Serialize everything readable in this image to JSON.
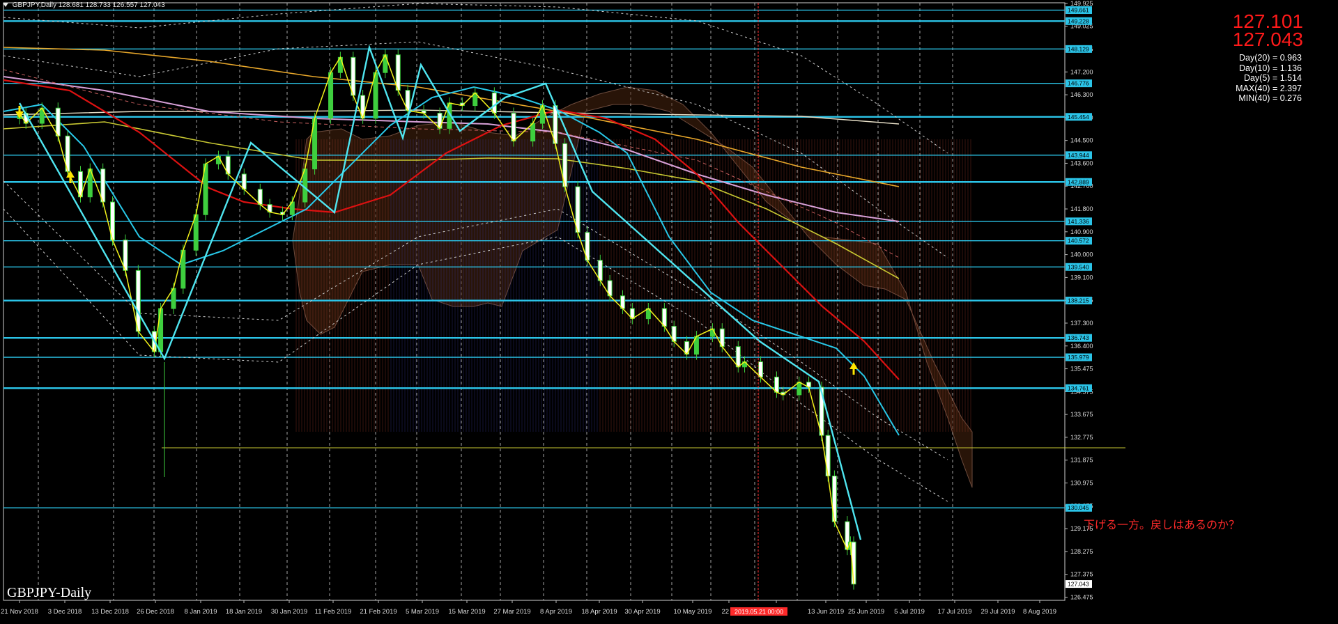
{
  "window": {
    "symbol_title": "GBPJPY,Daily",
    "ohlc": "128.681 128.733 126.557 127.043"
  },
  "quote": {
    "ask": "127.101",
    "bid": "127.043"
  },
  "indicator_panel": [
    "Day(20) = 0.963",
    "Day(10) = 1.136",
    "Day(5) = 1.514",
    "MAX(40) = 2.397",
    "MIN(40) = 0.276"
  ],
  "watermark": "GBPJPY-Daily",
  "annotation_text": "下げる一方。戻しはあるのか？",
  "crosshair_date_label": "2019.05.21 00:00",
  "price_ticks": [
    "149.925",
    "149.025",
    "148.125",
    "147.200",
    "146.300",
    "145.400",
    "144.500",
    "143.600",
    "142.700",
    "141.800",
    "140.900",
    "140.000",
    "139.100",
    "138.175",
    "137.300",
    "136.400",
    "135.475",
    "134.575",
    "133.675",
    "132.775",
    "131.875",
    "130.975",
    "130.075",
    "129.175",
    "128.275",
    "127.375",
    "126.475"
  ],
  "level_labels": [
    {
      "price": "149.661",
      "color": "#2bc4e8"
    },
    {
      "price": "149.228",
      "color": "#2bc4e8"
    },
    {
      "price": "148.129",
      "color": "#2bc4e8"
    },
    {
      "price": "146.776",
      "color": "#2bc4e8"
    },
    {
      "price": "145.454",
      "color": "#2bc4e8"
    },
    {
      "price": "143.944",
      "color": "#2bc4e8"
    },
    {
      "price": "142.889",
      "color": "#2bc4e8"
    },
    {
      "price": "141.336",
      "color": "#2bc4e8"
    },
    {
      "price": "140.572",
      "color": "#2bc4e8"
    },
    {
      "price": "139.540",
      "color": "#2bc4e8"
    },
    {
      "price": "138.215",
      "color": "#2bc4e8"
    },
    {
      "price": "136.743",
      "color": "#2bc4e8"
    },
    {
      "price": "135.979",
      "color": "#2bc4e8"
    },
    {
      "price": "134.761",
      "color": "#2bc4e8"
    },
    {
      "price": "130.045",
      "color": "#2bc4e8"
    },
    {
      "price": "127.043",
      "color": "#ffffff"
    }
  ],
  "date_ticks": [
    "21 Nov 2018",
    "3 Dec 2018",
    "13 Dec 2018",
    "26 Dec 2018",
    "8 Jan 2019",
    "18 Jan 2019",
    "30 Jan 2019",
    "11 Feb 2019",
    "21 Feb 2019",
    "5 Mar 2019",
    "15 Mar 2019",
    "27 Mar 2019",
    "8 Apr 2019",
    "18 Apr 2019",
    "30 Apr 2019",
    "10 May 2019",
    "22 M",
    "19",
    "13 Jun 2019",
    "25 Jun 2019",
    "5 Jul 2019",
    "17 Jul 2019",
    "29 Jul 2019",
    "8 Aug 2019"
  ],
  "chart_data": {
    "type": "candlestick",
    "symbol": "GBPJPY",
    "timeframe": "Daily",
    "ylim": [
      126.4,
      149.95
    ],
    "horizontal_levels": [
      149.661,
      149.228,
      148.129,
      146.776,
      145.454,
      143.944,
      142.889,
      141.336,
      140.572,
      139.54,
      138.215,
      136.743,
      135.979,
      134.761,
      130.045
    ],
    "close_path": [
      [
        "21 Nov 2018",
        145.6
      ],
      [
        "23 Nov 2018",
        145.2
      ],
      [
        "28 Nov 2018",
        145.8
      ],
      [
        "3 Dec 2018",
        144.7
      ],
      [
        "6 Dec 2018",
        143.3
      ],
      [
        "10 Dec 2018",
        142.3
      ],
      [
        "13 Dec 2018",
        143.4
      ],
      [
        "17 Dec 2018",
        142.1
      ],
      [
        "20 Dec 2018",
        140.6
      ],
      [
        "24 Dec 2018",
        139.4
      ],
      [
        "28 Dec 2018",
        137.0
      ],
      [
        "2 Jan 2019",
        136.2
      ],
      [
        "4 Jan 2019",
        137.9
      ],
      [
        "8 Jan 2019",
        138.7
      ],
      [
        "11 Jan 2019",
        140.2
      ],
      [
        "15 Jan 2019",
        141.6
      ],
      [
        "18 Jan 2019",
        143.6
      ],
      [
        "22 Jan 2019",
        143.9
      ],
      [
        "25 Jan 2019",
        143.2
      ],
      [
        "30 Jan 2019",
        142.6
      ],
      [
        "4 Feb 2019",
        142.0
      ],
      [
        "7 Feb 2019",
        141.7
      ],
      [
        "11 Feb 2019",
        141.6
      ],
      [
        "14 Feb 2019",
        142.1
      ],
      [
        "18 Feb 2019",
        143.4
      ],
      [
        "21 Feb 2019",
        145.4
      ],
      [
        "26 Feb 2019",
        147.2
      ],
      [
        "1 Mar 2019",
        147.8
      ],
      [
        "5 Mar 2019",
        146.3
      ],
      [
        "8 Mar 2019",
        145.4
      ],
      [
        "12 Mar 2019",
        147.2
      ],
      [
        "15 Mar 2019",
        147.9
      ],
      [
        "19 Mar 2019",
        146.5
      ],
      [
        "22 Mar 2019",
        145.7
      ],
      [
        "27 Mar 2019",
        145.6
      ],
      [
        "1 Apr 2019",
        145.0
      ],
      [
        "4 Apr 2019",
        146.0
      ],
      [
        "8 Apr 2019",
        145.9
      ],
      [
        "12 Apr 2019",
        146.4
      ],
      [
        "18 Apr 2019",
        145.6
      ],
      [
        "24 Apr 2019",
        144.5
      ],
      [
        "30 Apr 2019",
        145.2
      ],
      [
        "3 May 2019",
        145.9
      ],
      [
        "7 May 2019",
        144.4
      ],
      [
        "10 May 2019",
        142.7
      ],
      [
        "14 May 2019",
        140.9
      ],
      [
        "17 May 2019",
        139.8
      ],
      [
        "21 May 2019",
        139.0
      ],
      [
        "24 May 2019",
        138.4
      ],
      [
        "28 May 2019",
        137.9
      ],
      [
        "31 May 2019",
        137.5
      ],
      [
        "5 Jun 2019",
        137.9
      ],
      [
        "10 Jun 2019",
        137.2
      ],
      [
        "13 Jun 2019",
        136.6
      ],
      [
        "17 Jun 2019",
        136.1
      ],
      [
        "20 Jun 2019",
        136.8
      ],
      [
        "25 Jun 2019",
        137.1
      ],
      [
        "28 Jun 2019",
        136.4
      ],
      [
        "3 Jul 2019",
        135.6
      ],
      [
        "5 Jul 2019",
        135.8
      ],
      [
        "10 Jul 2019",
        135.2
      ],
      [
        "15 Jul 2019",
        134.6
      ],
      [
        "17 Jul 2019",
        134.5
      ],
      [
        "22 Jul 2019",
        135.0
      ],
      [
        "25 Jul 2019",
        134.8
      ],
      [
        "29 Jul 2019",
        132.9
      ],
      [
        "31 Jul 2019",
        131.3
      ],
      [
        "2 Aug 2019",
        129.5
      ],
      [
        "6 Aug 2019",
        128.4
      ],
      [
        "7 Aug 2019",
        128.7
      ],
      [
        "8 Aug 2019",
        127.04
      ]
    ]
  }
}
